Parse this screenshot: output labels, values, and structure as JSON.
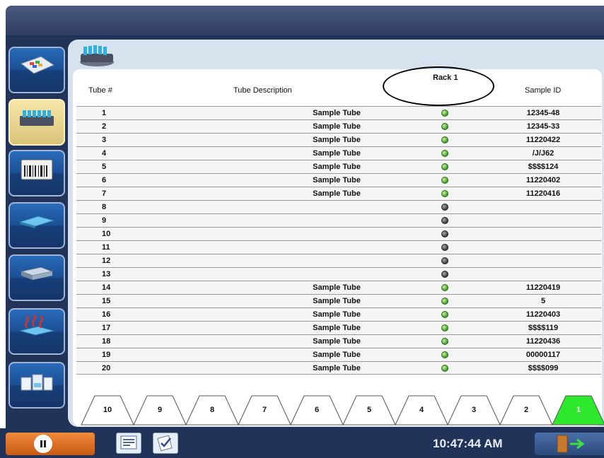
{
  "sidebar": {
    "items": [
      {
        "id": "overview-icon",
        "active": false
      },
      {
        "id": "rack-icon",
        "active": true
      },
      {
        "id": "barcode-rack-icon",
        "active": false
      },
      {
        "id": "slide-tray-icon",
        "active": false
      },
      {
        "id": "cartridge-icon",
        "active": false
      },
      {
        "id": "heater-icon",
        "active": false
      },
      {
        "id": "reagent-icon",
        "active": false
      }
    ]
  },
  "table": {
    "rack_title": "Rack 1",
    "headers": {
      "tube_num": "Tube #",
      "description": "Tube Description",
      "sample_id": "Sample ID"
    },
    "rows": [
      {
        "num": "1",
        "desc": "Sample Tube",
        "status": "green",
        "sid": "12345-48"
      },
      {
        "num": "2",
        "desc": "Sample Tube",
        "status": "green",
        "sid": "12345-33"
      },
      {
        "num": "3",
        "desc": "Sample Tube",
        "status": "green",
        "sid": "11220422"
      },
      {
        "num": "4",
        "desc": "Sample Tube",
        "status": "green",
        "sid": "/J/J62"
      },
      {
        "num": "5",
        "desc": "Sample Tube",
        "status": "green",
        "sid": "$$$$124"
      },
      {
        "num": "6",
        "desc": "Sample Tube",
        "status": "green",
        "sid": "11220402"
      },
      {
        "num": "7",
        "desc": "Sample Tube",
        "status": "green",
        "sid": "11220416"
      },
      {
        "num": "8",
        "desc": "",
        "status": "gray",
        "sid": ""
      },
      {
        "num": "9",
        "desc": "",
        "status": "gray",
        "sid": ""
      },
      {
        "num": "10",
        "desc": "",
        "status": "gray",
        "sid": ""
      },
      {
        "num": "11",
        "desc": "",
        "status": "gray",
        "sid": ""
      },
      {
        "num": "12",
        "desc": "",
        "status": "gray",
        "sid": ""
      },
      {
        "num": "13",
        "desc": "",
        "status": "gray",
        "sid": ""
      },
      {
        "num": "14",
        "desc": "Sample Tube",
        "status": "green",
        "sid": "11220419"
      },
      {
        "num": "15",
        "desc": "Sample Tube",
        "status": "green",
        "sid": "5"
      },
      {
        "num": "16",
        "desc": "Sample Tube",
        "status": "green",
        "sid": "11220403"
      },
      {
        "num": "17",
        "desc": "Sample Tube",
        "status": "green",
        "sid": "$$$$119"
      },
      {
        "num": "18",
        "desc": "Sample Tube",
        "status": "green",
        "sid": "11220436"
      },
      {
        "num": "19",
        "desc": "Sample Tube",
        "status": "green",
        "sid": "00000117"
      },
      {
        "num": "20",
        "desc": "Sample Tube",
        "status": "green",
        "sid": "$$$$099"
      }
    ]
  },
  "rack_tabs": [
    {
      "label": "10",
      "active": false
    },
    {
      "label": "9",
      "active": false
    },
    {
      "label": "8",
      "active": false
    },
    {
      "label": "7",
      "active": false
    },
    {
      "label": "6",
      "active": false
    },
    {
      "label": "5",
      "active": false
    },
    {
      "label": "4",
      "active": false
    },
    {
      "label": "3",
      "active": false
    },
    {
      "label": "2",
      "active": false
    },
    {
      "label": "1",
      "active": true
    }
  ],
  "status_bar": {
    "clock": "10:47:44 AM"
  },
  "colors": {
    "active_tab": "#2ee82e",
    "status_green": "#4caf2a",
    "status_gray": "#4a4a4a",
    "frame": "#22335a"
  }
}
